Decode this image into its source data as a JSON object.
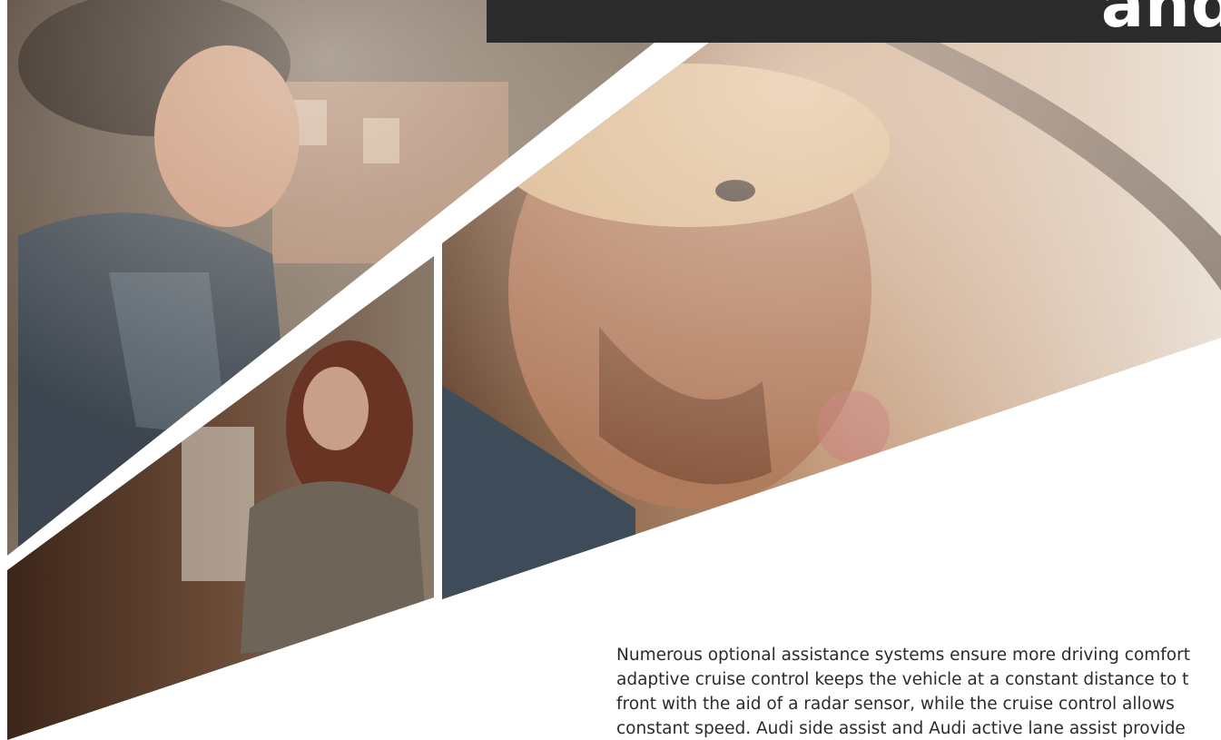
{
  "headline": {
    "text": "and"
  },
  "body_copy": {
    "lines": [
      "Numerous optional assistance systems ensure more driving comfort",
      "adaptive cruise control keeps the vehicle at a constant distance to t",
      "front with the aid of a radar sensor, while the cruise control allows",
      "constant speed. Audi side assist and Audi active lane assist provide"
    ]
  },
  "photos": [
    {
      "subject": "man-driving-looking-left"
    },
    {
      "subject": "woman-in-leather-jacket-street"
    },
    {
      "subject": "man-close-up-behind-wheel"
    }
  ],
  "colors": {
    "headline_bar": "#2b2b2b",
    "headline_text": "#ffffff",
    "body_text": "#2b2b2b",
    "background": "#ffffff"
  }
}
